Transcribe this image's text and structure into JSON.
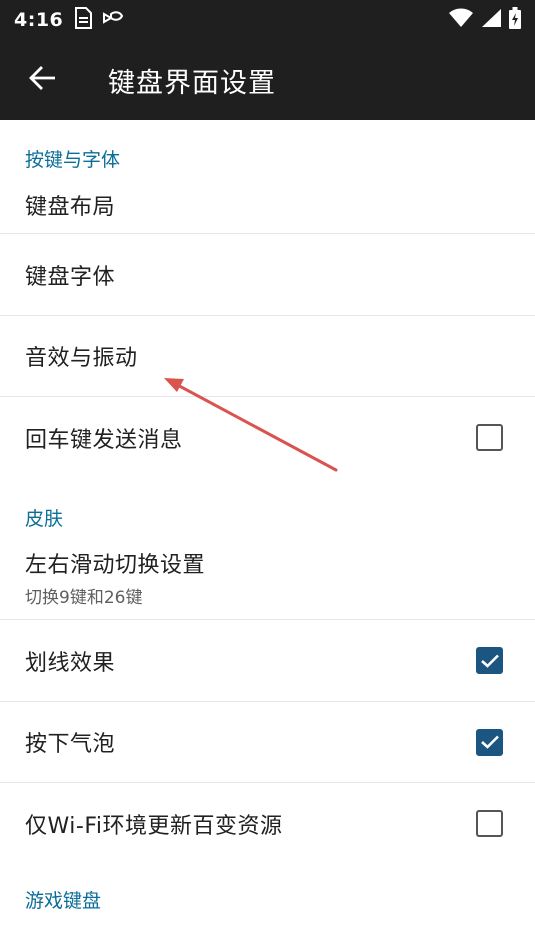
{
  "status_bar": {
    "time": "4:16",
    "left_icons": [
      "document-icon",
      "cast-icon"
    ],
    "right_icons": [
      "wifi-icon",
      "signal-icon",
      "battery-charging-icon"
    ]
  },
  "app_bar": {
    "back_icon": "arrow-left-icon",
    "title": "键盘界面设置"
  },
  "sections": [
    {
      "header": "按键与字体",
      "items": [
        {
          "title": "键盘布局"
        },
        {
          "title": "键盘字体"
        },
        {
          "title": "音效与振动"
        },
        {
          "title": "回车键发送消息",
          "checkbox": false
        }
      ]
    },
    {
      "header": "皮肤",
      "items": [
        {
          "title": "左右滑动切换设置",
          "summary": "切换9键和26键"
        },
        {
          "title": "划线效果",
          "checkbox": true
        },
        {
          "title": "按下气泡",
          "checkbox": true
        },
        {
          "title": "仅Wi-Fi环境更新百变资源",
          "checkbox": false
        }
      ]
    },
    {
      "header": "游戏键盘"
    }
  ],
  "colors": {
    "app_bar_bg": "#1f1f1f",
    "category_text": "#0b6e99",
    "checkbox_checked": "#1a5680",
    "annotation_arrow": "#d9534f"
  }
}
